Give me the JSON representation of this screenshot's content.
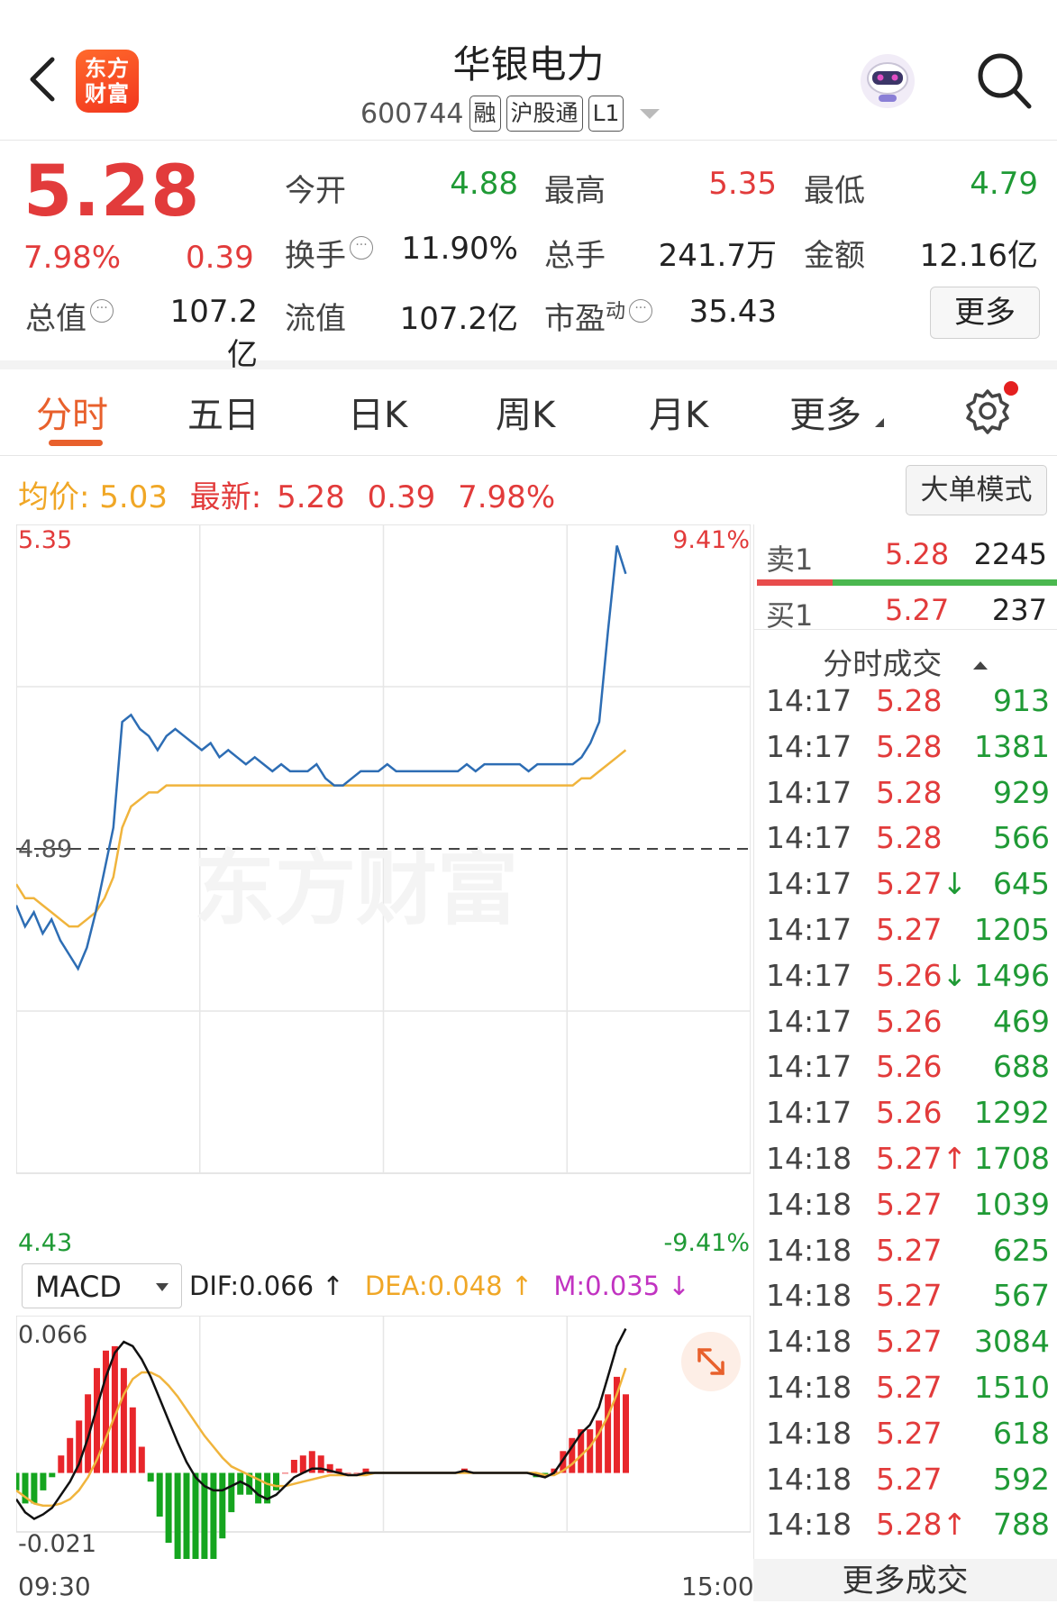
{
  "header": {
    "title": "华银电力",
    "code": "600744",
    "tags": [
      "融",
      "沪股通",
      "L1"
    ],
    "logo_text_line1": "东方",
    "logo_text_line2": "财富"
  },
  "quote": {
    "price": "5.28",
    "change_pct": "7.98%",
    "change": "0.39",
    "open_label": "今开",
    "open": "4.88",
    "high_label": "最高",
    "high": "5.35",
    "low_label": "最低",
    "low": "4.79",
    "turnover_label": "换手",
    "turnover": "11.90%",
    "volume_label": "总手",
    "volume": "241.7万",
    "amount_label": "金额",
    "amount": "12.16亿",
    "mktcap_label": "总值",
    "mktcap": "107.2亿",
    "float_label": "流值",
    "float_cap": "107.2亿",
    "pe_label": "市盈",
    "pe_sup": "动",
    "pe": "35.43",
    "more_label": "更多"
  },
  "tabs": [
    "分时",
    "五日",
    "日K",
    "周K",
    "月K",
    "更多"
  ],
  "info_row": {
    "avg_label": "均价:",
    "avg": "5.03",
    "latest_label": "最新:",
    "latest": "5.28",
    "change": "0.39",
    "change_pct": "7.98%",
    "big_order_label": "大单模式"
  },
  "chart_labels": {
    "top_price": "5.35",
    "bottom_price": "4.43",
    "prev_close": "4.89",
    "top_pct": "9.41%",
    "bottom_pct": "-9.41%",
    "start_time": "09:30",
    "end_time": "15:00",
    "watermark": "东方财富"
  },
  "macd": {
    "selector_label": "MACD",
    "dif": "DIF:0.066 ↑",
    "dea": "DEA:0.048 ↑",
    "m": "M:0.035 ↓",
    "top_label": "0.066",
    "bottom_label": "-0.021"
  },
  "order_book": {
    "sell1_label": "卖1",
    "sell1_price": "5.28",
    "sell1_vol": "2245",
    "buy1_label": "买1",
    "buy1_price": "5.27",
    "buy1_vol": "237",
    "trades_header": "分时成交",
    "more_trades": "更多成交"
  },
  "trades": [
    {
      "time": "14:17",
      "price": "5.28",
      "vol": "913"
    },
    {
      "time": "14:17",
      "price": "5.28",
      "vol": "1381"
    },
    {
      "time": "14:17",
      "price": "5.28",
      "vol": "929"
    },
    {
      "time": "14:17",
      "price": "5.28",
      "vol": "566"
    },
    {
      "time": "14:17",
      "price": "5.27↓",
      "vol": "645"
    },
    {
      "time": "14:17",
      "price": "5.27",
      "vol": "1205"
    },
    {
      "time": "14:17",
      "price": "5.26↓",
      "vol": "1496"
    },
    {
      "time": "14:17",
      "price": "5.26",
      "vol": "469"
    },
    {
      "time": "14:17",
      "price": "5.26",
      "vol": "688"
    },
    {
      "time": "14:17",
      "price": "5.26",
      "vol": "1292"
    },
    {
      "time": "14:18",
      "price": "5.27↑",
      "vol": "1708"
    },
    {
      "time": "14:18",
      "price": "5.27",
      "vol": "1039"
    },
    {
      "time": "14:18",
      "price": "5.27",
      "vol": "625"
    },
    {
      "time": "14:18",
      "price": "5.27",
      "vol": "567"
    },
    {
      "time": "14:18",
      "price": "5.27",
      "vol": "3084"
    },
    {
      "time": "14:18",
      "price": "5.27",
      "vol": "1510"
    },
    {
      "time": "14:18",
      "price": "5.27",
      "vol": "618"
    },
    {
      "time": "14:18",
      "price": "5.27",
      "vol": "592"
    },
    {
      "time": "14:18",
      "price": "5.28↑",
      "vol": "788"
    }
  ],
  "colors": {
    "up": "#e23b3b",
    "down": "#1f9a35",
    "accent": "#e8602c",
    "price_line": "#2d6db4",
    "avg_line": "#f0b43c",
    "dif": "#111111",
    "dea": "#f0b43c"
  },
  "chart_data": {
    "type": "line",
    "y_range": [
      4.43,
      5.35
    ],
    "prev_close": 4.89,
    "price_series": [
      4.81,
      4.78,
      4.8,
      4.77,
      4.79,
      4.76,
      4.74,
      4.72,
      4.75,
      4.8,
      4.86,
      4.92,
      5.07,
      5.08,
      5.06,
      5.05,
      5.03,
      5.05,
      5.06,
      5.05,
      5.04,
      5.03,
      5.04,
      5.02,
      5.03,
      5.02,
      5.01,
      5.02,
      5.01,
      5.0,
      5.01,
      5.0,
      5.0,
      5.0,
      5.01,
      4.99,
      4.98,
      4.98,
      4.99,
      5.0,
      5.0,
      5.0,
      5.01,
      5.0,
      5.0,
      5.0,
      5.0,
      5.0,
      5.0,
      5.0,
      5.0,
      5.01,
      5.0,
      5.01,
      5.01,
      5.01,
      5.01,
      5.01,
      5.0,
      5.01,
      5.01,
      5.01,
      5.01,
      5.01,
      5.02,
      5.04,
      5.07,
      5.2,
      5.32,
      5.28
    ],
    "avg_series": [
      4.84,
      4.82,
      4.82,
      4.81,
      4.8,
      4.79,
      4.78,
      4.78,
      4.79,
      4.8,
      4.82,
      4.85,
      4.92,
      4.95,
      4.96,
      4.97,
      4.97,
      4.98,
      4.98,
      4.98,
      4.98,
      4.98,
      4.98,
      4.98,
      4.98,
      4.98,
      4.98,
      4.98,
      4.98,
      4.98,
      4.98,
      4.98,
      4.98,
      4.98,
      4.98,
      4.98,
      4.98,
      4.98,
      4.98,
      4.98,
      4.98,
      4.98,
      4.98,
      4.98,
      4.98,
      4.98,
      4.98,
      4.98,
      4.98,
      4.98,
      4.98,
      4.98,
      4.98,
      4.98,
      4.98,
      4.98,
      4.98,
      4.98,
      4.98,
      4.98,
      4.98,
      4.98,
      4.98,
      4.98,
      4.99,
      4.99,
      5.0,
      5.01,
      5.02,
      5.03
    ],
    "macd_range": [
      -0.021,
      0.066
    ],
    "dif_series": [
      -0.012,
      -0.018,
      -0.021,
      -0.019,
      -0.016,
      -0.01,
      -0.004,
      0.004,
      0.016,
      0.03,
      0.044,
      0.055,
      0.06,
      0.058,
      0.052,
      0.044,
      0.034,
      0.024,
      0.014,
      0.005,
      -0.002,
      -0.006,
      -0.008,
      -0.008,
      -0.006,
      -0.004,
      -0.006,
      -0.01,
      -0.012,
      -0.01,
      -0.006,
      -0.002,
      0.0,
      0.002,
      0.002,
      0.001,
      0.0,
      -0.001,
      -0.001,
      0.0,
      0.0,
      0.0,
      0.0,
      0.0,
      0.0,
      0.0,
      0.0,
      0.0,
      0.0,
      0.0,
      0.001,
      0.0,
      0.0,
      0.0,
      0.0,
      0.0,
      0.0,
      0.0,
      -0.001,
      -0.002,
      0.0,
      0.006,
      0.012,
      0.018,
      0.022,
      0.03,
      0.044,
      0.058,
      0.066
    ],
    "dea_series": [
      -0.008,
      -0.011,
      -0.014,
      -0.015,
      -0.015,
      -0.014,
      -0.012,
      -0.008,
      -0.002,
      0.006,
      0.016,
      0.026,
      0.036,
      0.043,
      0.046,
      0.046,
      0.044,
      0.04,
      0.035,
      0.029,
      0.023,
      0.017,
      0.012,
      0.007,
      0.003,
      0.001,
      -0.001,
      -0.003,
      -0.005,
      -0.006,
      -0.006,
      -0.005,
      -0.004,
      -0.003,
      -0.002,
      -0.001,
      -0.001,
      -0.001,
      -0.001,
      -0.001,
      0.0,
      0.0,
      0.0,
      0.0,
      0.0,
      0.0,
      0.0,
      0.0,
      0.0,
      0.0,
      0.0,
      0.0,
      0.0,
      0.0,
      0.0,
      0.0,
      0.0,
      0.0,
      0.0,
      -0.001,
      -0.001,
      0.001,
      0.004,
      0.008,
      0.012,
      0.018,
      0.026,
      0.036,
      0.048
    ]
  }
}
